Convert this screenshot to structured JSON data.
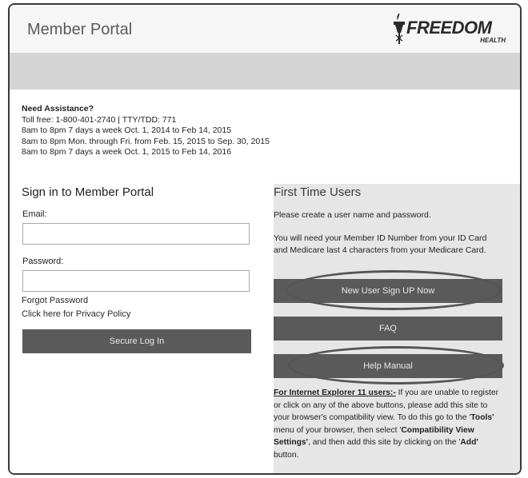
{
  "header": {
    "title": "Member Portal",
    "logo_text": "FREEDOM",
    "logo_subtext": "HEALTH"
  },
  "assistance": {
    "title": "Need Assistance?",
    "lines": [
      "Toll free: 1-800-401-2740 | TTY/TDD: 771",
      "8am to 8pm 7 days a week Oct. 1, 2014 to Feb 14, 2015",
      "8am to 8pm Mon. through Fri. from Feb. 15, 2015 to Sep. 30, 2015",
      "8am to 8pm 7 days a week Oct. 1, 2015 to Feb 14, 2016"
    ]
  },
  "signin": {
    "title": "Sign in to Member Portal",
    "email_label": "Email:",
    "email_value": "",
    "password_label": "Password:",
    "password_value": "",
    "forgot_password": "Forgot Password",
    "privacy": "Click here for Privacy Policy",
    "login_button": "Secure Log In"
  },
  "first_time": {
    "title": "First Time Users",
    "intro": "Please create a user name and password.",
    "info": "You will need your Member ID Number from your ID Card and Medicare last 4 characters from your Medicare Card.",
    "signup_button": "New User Sign UP Now",
    "faq_button": "FAQ",
    "help_button": "Help Manual"
  },
  "ie_note": {
    "heading": "For Internet Explorer 11 users:-",
    "text1": " If you are unable to register or click on any of the above buttons, please add this site to your browser's compatibility view. To do this go to the '",
    "tools": "Tools'",
    "text2": " menu of your browser, then select '",
    "compat": "Compatibility View Settings'",
    "text3": ", and then add this site by clicking on the '",
    "add": "Add'",
    "text4": " button."
  }
}
